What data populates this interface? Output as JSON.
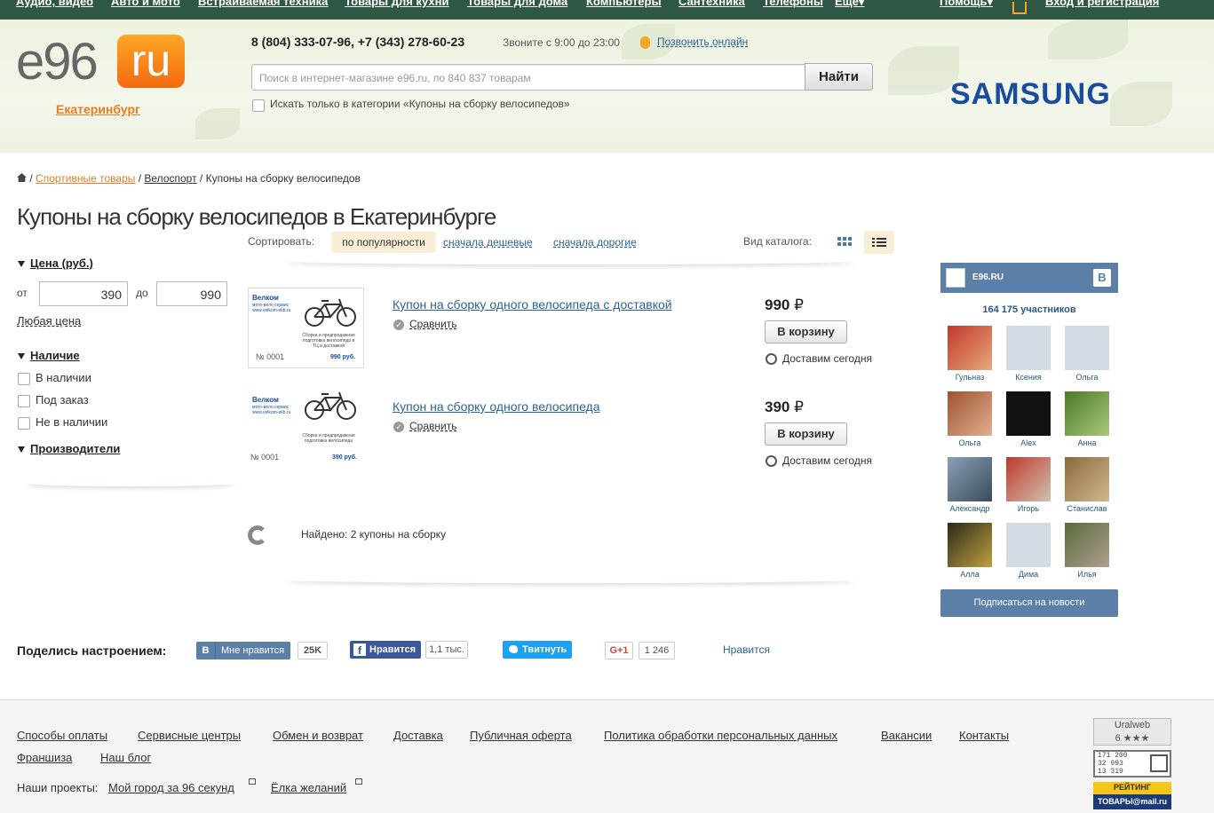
{
  "topnav": [
    "Аудио, видео",
    "Авто и мото",
    "Встраиваемая техника",
    "Товары для кухни",
    "Товары для дома",
    "Компьютеры",
    "Сантехника",
    "Телефоны",
    "Ещё▾",
    "Помощь▾",
    "Вход и регистрация"
  ],
  "header": {
    "city": "Екатеринбург",
    "phone": "8 (804) 333-07-96, +7 (343) 278-60-23",
    "call_hours": "Звоните с 9:00 до 23:00",
    "call_online": "Позвонить онлайн",
    "search_placeholder": "Поиск в интернет-магазине e96.ru, по 840 837 товарам",
    "search_button": "Найти",
    "only_category": "Искать только в категории «Купоны на сборку велосипедов»",
    "banner": "SAMSUNG",
    "logo_left": "e96",
    "logo_right": "ru"
  },
  "breadcrumb": {
    "sep": "/",
    "sport": "Спортивные товары",
    "velo": "Велоспорт",
    "current": "Купоны на сборку велосипедов"
  },
  "title": "Купоны на сборку велосипедов в Екатеринбурге",
  "filters": {
    "price_head": "Цена (руб.)",
    "from_label": "от",
    "from_value": "390",
    "to_label": "до",
    "to_value": "990",
    "any_price": "Любая цена",
    "avail_head": "Наличие",
    "avail": [
      "В наличии",
      "Под заказ",
      "Не в наличии"
    ],
    "makers_head": "Производители"
  },
  "sort": {
    "label": "Сортировать:",
    "active": "по популярности",
    "cheap": "сначала дешевые",
    "expensive": "сначала дорогие",
    "view_label": "Вид каталога:"
  },
  "products": [
    {
      "title": "Купон на сборку одного велосипеда с доставкой",
      "price": "990",
      "currency": "₽",
      "compare": "Сравнить",
      "cart": "В корзину",
      "delivery": "Доставим сегодня",
      "img_brand": "Велком",
      "img_sub": "мото-вело сервис",
      "img_site": "www.velkom-ekb.ru",
      "img_desc": "Сборка и предпродажная подготовка велосипеда в ТЦ и доставкой",
      "img_no": "№ 0001",
      "img_price": "990 руб."
    },
    {
      "title": "Купон на сборку одного велосипеда",
      "price": "390",
      "currency": "₽",
      "compare": "Сравнить",
      "cart": "В корзину",
      "delivery": "Доставим сегодня",
      "img_brand": "Велком",
      "img_sub": "мото-вело сервис",
      "img_site": "www.velkom-ekb.ru",
      "img_desc": "Сборка и предпродажная подготовка велосипеда",
      "img_no": "№ 0001",
      "img_price": "390 руб."
    }
  ],
  "found": "Найдено: 2 купоны на сборку",
  "vk": {
    "name": "E96.RU",
    "b": "B",
    "count": "164 175 участников",
    "members": [
      "Гульназ",
      "Ксения",
      "Ольга",
      "Ольга",
      "Alex",
      "Анна",
      "Александр",
      "Игорь",
      "Станислав",
      "Алла",
      "Дима",
      "Илья"
    ],
    "subscribe": "Подписаться на новости"
  },
  "share": {
    "label": "Поделись настроением:",
    "vk_b": "B",
    "vk": "Мне нравится",
    "vk_count": "25K",
    "fb": "Нравится",
    "fb_count": "1,1 тыс.",
    "tw": "Твитнуть",
    "gp": "G+1",
    "gp_count": "1 246",
    "like": "Нравится"
  },
  "footer": {
    "links": [
      "Способы оплаты",
      "Сервисные центры",
      "Обмен и возврат",
      "Доставка",
      "Публичная оферта",
      "Политика обработки персональных данных",
      "Вакансии",
      "Контакты"
    ],
    "links2": [
      "Франшиза",
      "Наш блог"
    ],
    "projects_label": "Наши проекты:",
    "project1": "Мой город за 96 секунд",
    "project2": "Ёлка желаний",
    "uralweb": "Uralweb",
    "uralweb_rating": "6 ★★★",
    "counter": [
      "171 200",
      "32 993",
      "13 319"
    ],
    "mail_top": "РЕЙТИНГ",
    "mail_bottom": "ТОВАРЫ@mail.ru"
  },
  "colors": {
    "accent": "#e67e22",
    "link": "#2a6496",
    "topnav": "#2e5744",
    "vk": "#5b7fa6"
  }
}
